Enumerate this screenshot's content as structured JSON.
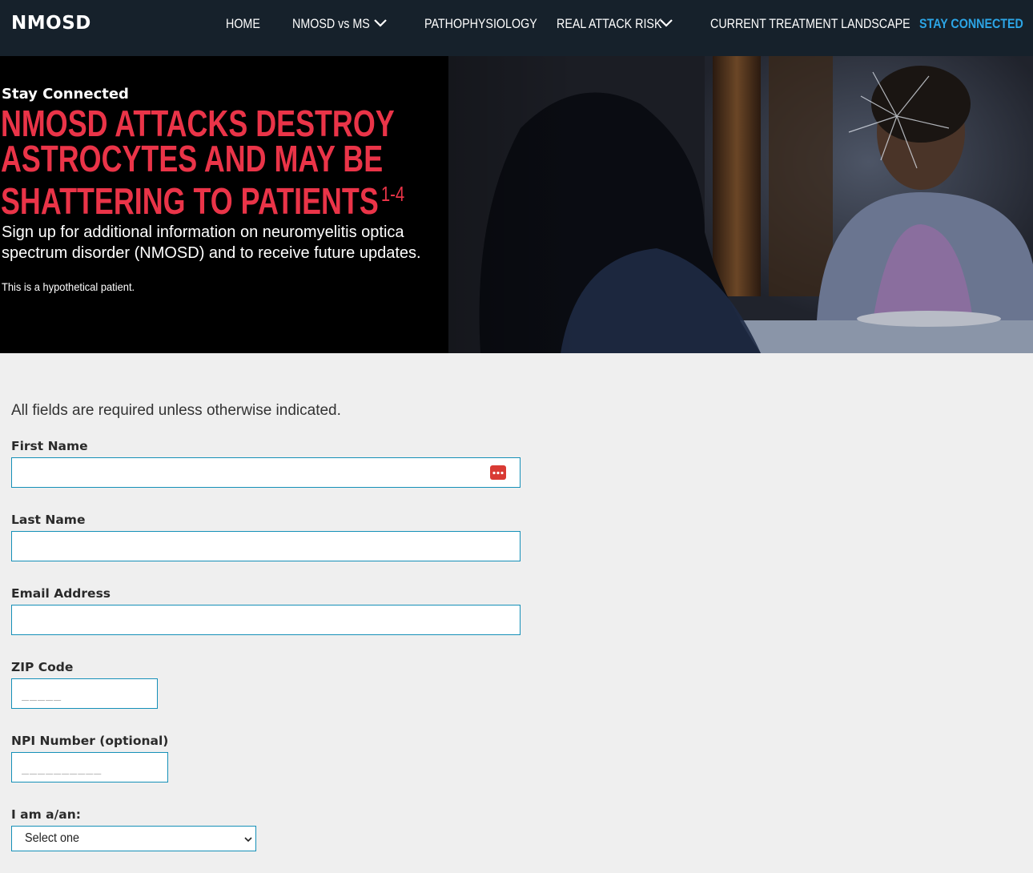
{
  "nav": {
    "logo": "NMOSD",
    "items": [
      {
        "label": "HOME"
      },
      {
        "label": "NMOSD vs MS"
      },
      {
        "label": "PATHOPHYSIOLOGY"
      },
      {
        "label": "REAL ATTACK RISK"
      },
      {
        "label": "CURRENT TREATMENT LANDSCAPE"
      },
      {
        "label": "STAY CONNECTED"
      }
    ],
    "active_color": "#2ca5e6",
    "background": "#16212b"
  },
  "hero": {
    "eyebrow": "Stay Connected",
    "headline_lines": [
      "NMOSD ATTACKS DESTROY",
      "ASTROCYTES AND MAY BE",
      "SHATTERING TO PATIENTS"
    ],
    "headline_sup": "1-4",
    "body_lines": [
      "Sign up for additional information on neuromyelitis optica",
      "spectrum disorder (NMOSD) and to receive future updates."
    ],
    "note": "This is a hypothetical patient.",
    "accent_color": "#ea3448"
  },
  "form": {
    "intro": "All fields are required unless otherwise indicated.",
    "first_name": {
      "label": "First Name",
      "value": "",
      "placeholder": ""
    },
    "last_name": {
      "label": "Last Name",
      "value": "",
      "placeholder": ""
    },
    "email": {
      "label": "Email Address",
      "value": "",
      "placeholder": ""
    },
    "zip": {
      "label": "ZIP Code",
      "value": "",
      "placeholder": "_____"
    },
    "npi": {
      "label": "NPI Number (optional)",
      "value": "",
      "placeholder": "__________"
    },
    "role": {
      "label": "I am a/an:",
      "selected": "Select one"
    },
    "border_color": "#1590b8"
  }
}
